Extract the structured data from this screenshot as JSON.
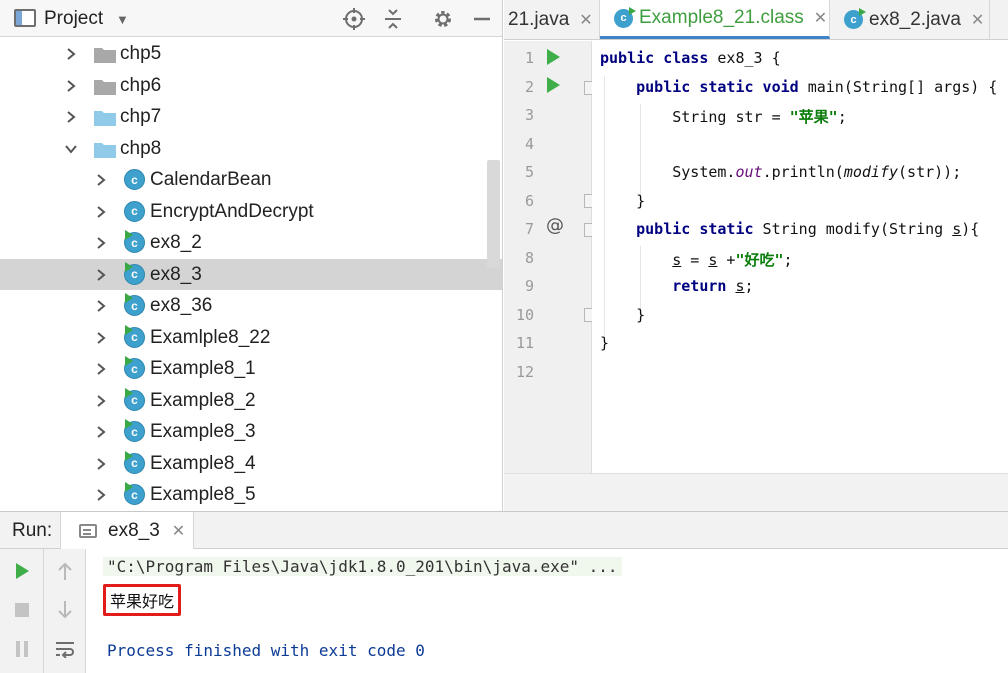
{
  "project": {
    "title": "Project",
    "header_icons": [
      "locate-icon",
      "collapse-all-icon",
      "gear-icon",
      "minimize-icon"
    ]
  },
  "tree": {
    "items": [
      {
        "label": "chp5",
        "kind": "folder",
        "expanded": false,
        "folder_color": "#a8a8a8"
      },
      {
        "label": "chp6",
        "kind": "folder",
        "expanded": false,
        "folder_color": "#a8a8a8"
      },
      {
        "label": "chp7",
        "kind": "folder",
        "expanded": false,
        "folder_color": "#8fcbe8"
      },
      {
        "label": "chp8",
        "kind": "folder",
        "expanded": true,
        "folder_color": "#8fcbe8"
      },
      {
        "label": "CalendarBean",
        "kind": "class",
        "runnable": false
      },
      {
        "label": "EncryptAndDecrypt",
        "kind": "class",
        "runnable": false
      },
      {
        "label": "ex8_2",
        "kind": "class",
        "runnable": true
      },
      {
        "label": "ex8_3",
        "kind": "class",
        "runnable": true,
        "selected": true
      },
      {
        "label": "ex8_36",
        "kind": "class",
        "runnable": true
      },
      {
        "label": "Examlple8_22",
        "kind": "class",
        "runnable": true
      },
      {
        "label": "Example8_1",
        "kind": "class",
        "runnable": true
      },
      {
        "label": "Example8_2",
        "kind": "class",
        "runnable": true
      },
      {
        "label": "Example8_3",
        "kind": "class",
        "runnable": true
      },
      {
        "label": "Example8_4",
        "kind": "class",
        "runnable": true
      },
      {
        "label": "Example8_5",
        "kind": "class",
        "runnable": true
      }
    ]
  },
  "editor": {
    "tabs": [
      {
        "label": "21.java",
        "active": false
      },
      {
        "label": "Example8_21.class",
        "active": true
      },
      {
        "label": "ex8_2.java",
        "active": false
      }
    ],
    "line_numbers": [
      "1",
      "2",
      "3",
      "4",
      "5",
      "6",
      "7",
      "8",
      "9",
      "10",
      "11",
      "12"
    ],
    "current_line": "12"
  },
  "run": {
    "title": "Run:",
    "tab_label": "ex8_3",
    "command": "\"C:\\Program Files\\Java\\jdk1.8.0_201\\bin\\java.exe\" ...",
    "output": "苹果好吃",
    "exit_message": "Process finished with exit code 0",
    "highlight_color": "#e21b1b"
  }
}
